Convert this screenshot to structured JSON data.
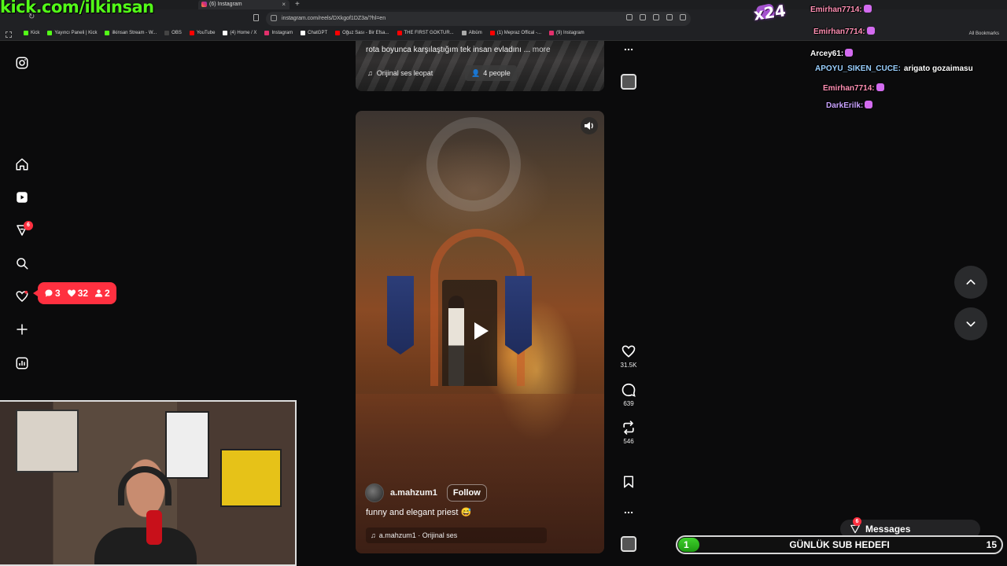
{
  "overlay": {
    "channel_url": "kick.com/ilkinsan"
  },
  "browser": {
    "tab_title": "(6) Instagram",
    "url": "instagram.com/reels/DXkgof1DZ3a/?hl=en",
    "bookmarks": [
      {
        "label": "Kick",
        "color": "#53fc18"
      },
      {
        "label": "Yayıncı Paneli | Kick",
        "color": "#53fc18"
      },
      {
        "label": "ilkinsan Stream - W...",
        "color": "#53fc18"
      },
      {
        "label": "OBS",
        "color": "#444444"
      },
      {
        "label": "YouTube",
        "color": "#ff0000"
      },
      {
        "label": "(4) Home / X",
        "color": "#ffffff"
      },
      {
        "label": "Instagram",
        "color": "#e1306c"
      },
      {
        "label": "ChatGPT",
        "color": "#ffffff"
      },
      {
        "label": "Oğuz Sası - Bir Efsa...",
        "color": "#ff0000"
      },
      {
        "label": "THE FIRST GOKTUR...",
        "color": "#ff0000"
      },
      {
        "label": "Albüm",
        "color": "#aaaaaa"
      },
      {
        "label": "(1) Mepraz Offical -...",
        "color": "#ff0000"
      },
      {
        "label": "(9) Instagram",
        "color": "#e1306c"
      }
    ],
    "all_bookmarks": "All Bookmarks"
  },
  "sidebar": {
    "explore_badge": "6",
    "notifications": {
      "comments": "3",
      "likes": "32",
      "follows": "2"
    }
  },
  "previous_reel": {
    "caption": "rota boyunca karşılaştığım tek insan evladını ...",
    "more": "more",
    "audio": "Orijinal ses  leopat",
    "people": "4 people"
  },
  "reel": {
    "username": "a.mahzum1",
    "follow_label": "Follow",
    "caption": "funny and elegant priest 😅",
    "audio": "a.mahzum1 · Orijinal ses",
    "likes": "31.5K",
    "comments": "639",
    "reposts": "546"
  },
  "chat": {
    "messages": [
      {
        "user": "Emirhan7714:",
        "text": "",
        "color": "#ff8fb3"
      },
      {
        "user": "Emirhan7714:",
        "text": "",
        "color": "#ff8fb3"
      },
      {
        "user": "Arcey61:",
        "text": "",
        "color": "#ffffff"
      },
      {
        "user": "APOYU_SIKEN_CUCE:",
        "text": "arigato gozaimasu",
        "color": "#9ad0ff"
      },
      {
        "user": "Emirhan7714:",
        "text": "",
        "color": "#ff8fb3"
      },
      {
        "user": "DarkErilk:",
        "text": "",
        "color": "#c9a3ff"
      }
    ],
    "gift_multiplier": "x24"
  },
  "messages_bar": {
    "label": "Messages",
    "badge": "6"
  },
  "sub_goal": {
    "title": "GÜNLÜK SUB HEDEFI",
    "current": "1",
    "target": "15",
    "progress": 0.0667
  }
}
